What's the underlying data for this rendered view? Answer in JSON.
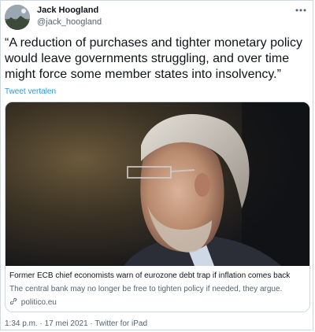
{
  "author": {
    "name": "Jack Hoogland",
    "handle": "@jack_hoogland",
    "avatar_icon": "profile-avatar"
  },
  "more_icon": "more-options-icon",
  "tweet": {
    "text": "“A reduction of purchases and tighter monetary policy would leave governments struggling, and over time might force some member states into insolvency.”",
    "translate_label": "Tweet vertalen"
  },
  "card": {
    "image_description_icon": "portrait-photo",
    "title": "Former ECB chief economists warn of eurozone debt trap if inflation comes back",
    "description": "The central bank may no longer be free to tighten policy if needed, they argue.",
    "domain": "politico.eu",
    "link_icon": "link-icon"
  },
  "footer": {
    "time": "1:34 p.m.",
    "separator": " · ",
    "date": "17 mei 2021",
    "source": "Twitter for iPad"
  },
  "colors": {
    "accent": "#1d9bf0",
    "text": "#0f1419",
    "muted": "#536471",
    "border": "#cfd9de"
  }
}
